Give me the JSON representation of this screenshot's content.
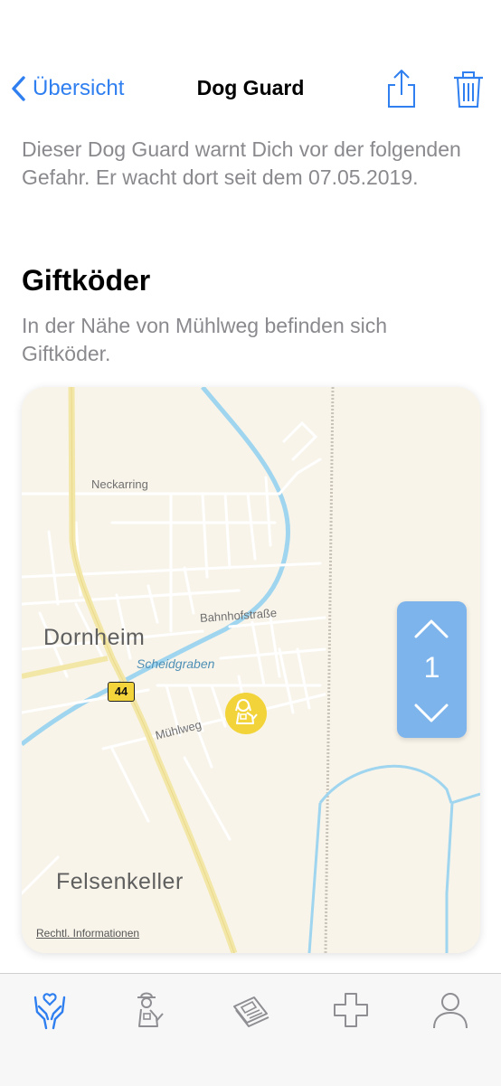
{
  "nav": {
    "back_label": "Übersicht",
    "title": "Dog Guard",
    "share_icon": "share-icon",
    "trash_icon": "trash-icon"
  },
  "intro_text": "Dieser Dog Guard warnt Dich vor der folgenden Gefahr. Er wacht dort seit dem 07.05.2019.",
  "hazard": {
    "title": "Giftköder",
    "description": "In der Nähe von Mühlweg befinden sich Giftköder."
  },
  "map": {
    "labels": {
      "neckarring": "Neckarring",
      "bahnhofstrasse": "Bahnhofstraße",
      "dornheim": "Dornheim",
      "scheidgraben": "Scheidgraben",
      "road_number": "44",
      "muehlweg": "Mühlweg",
      "felsenkeller": "Felsenkeller",
      "legal": "Rechtl. Informationen"
    },
    "marker_icon": "dog-marker-icon"
  },
  "counter": {
    "value": "1",
    "up_icon": "chevron-up-icon",
    "down_icon": "chevron-down-icon"
  },
  "tabs": [
    {
      "icon": "hands-care-icon",
      "active": true
    },
    {
      "icon": "dog-guard-icon",
      "active": false
    },
    {
      "icon": "newspaper-icon",
      "active": false
    },
    {
      "icon": "medical-cross-icon",
      "active": false
    },
    {
      "icon": "profile-icon",
      "active": false
    }
  ],
  "colors": {
    "accent": "#2f7ff0",
    "secondary_text": "#8a8a8e",
    "counter_bg": "#7db4ec",
    "marker": "#f2d43a",
    "water": "#9fd5ef"
  }
}
